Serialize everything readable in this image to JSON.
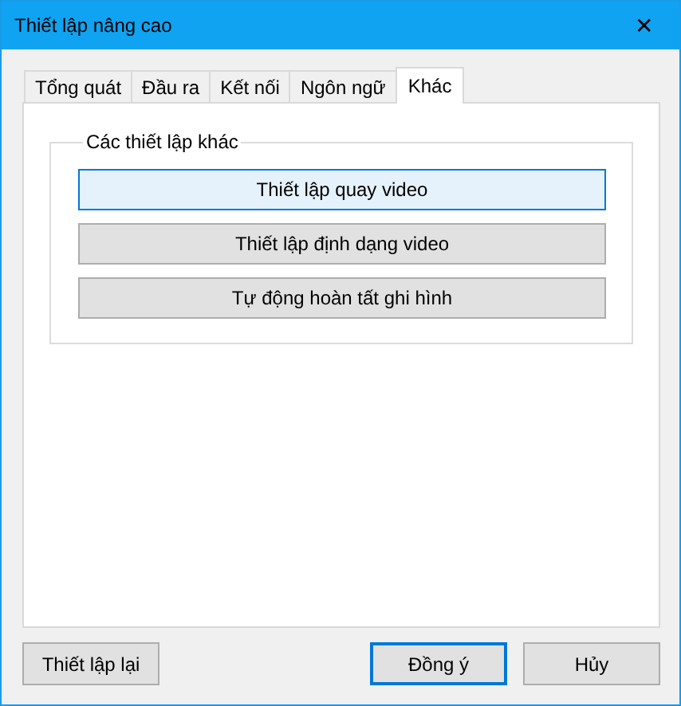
{
  "window": {
    "title": "Thiết lập nâng cao",
    "close": "✕"
  },
  "tabs": [
    {
      "label": "Tổng quát",
      "selected": false
    },
    {
      "label": "Đầu ra",
      "selected": false
    },
    {
      "label": "Kết nối",
      "selected": false
    },
    {
      "label": "Ngôn ngữ",
      "selected": false
    },
    {
      "label": "Khác",
      "selected": true
    }
  ],
  "group": {
    "title": "Các thiết lập khác",
    "buttons": [
      {
        "label": "Thiết lập quay video",
        "focused": true
      },
      {
        "label": "Thiết lập định dạng video",
        "focused": false
      },
      {
        "label": "Tự động hoàn tất ghi hình",
        "focused": false
      }
    ]
  },
  "footer": {
    "reset": "Thiết lập lại",
    "buttons": [
      {
        "label": "Đồng ý",
        "default": true
      },
      {
        "label": "Hủy",
        "default": false
      }
    ]
  }
}
